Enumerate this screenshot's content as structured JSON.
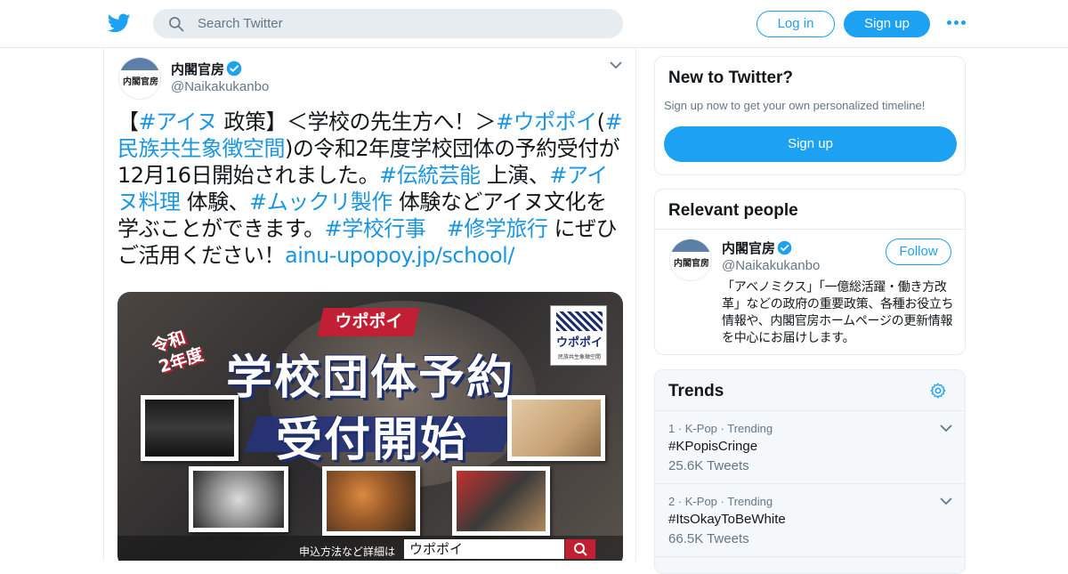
{
  "header": {
    "search_placeholder": "Search Twitter",
    "login_label": "Log in",
    "signup_label": "Sign up",
    "brand_color": "#1da1f2"
  },
  "tweet": {
    "author_name": "内閣官房",
    "author_handle": "@Naikakukanbo",
    "avatar_text": "内閣官房",
    "body": [
      {
        "t": "【",
        "k": "plain"
      },
      {
        "t": "#アイヌ",
        "k": "hashtag"
      },
      {
        "t": " 政策】＜学校の先生方へ！＞",
        "k": "plain"
      },
      {
        "t": "#ウポポイ",
        "k": "hashtag"
      },
      {
        "t": "(",
        "k": "plain"
      },
      {
        "t": "#民族共生象徴空間",
        "k": "hashtag"
      },
      {
        "t": ")の令和2年度学校団体の予約受付が12月16日開始されました。",
        "k": "plain"
      },
      {
        "t": "#伝統芸能",
        "k": "hashtag"
      },
      {
        "t": " 上演、",
        "k": "plain"
      },
      {
        "t": "#アイヌ料理",
        "k": "hashtag"
      },
      {
        "t": " 体験、",
        "k": "plain"
      },
      {
        "t": "#ムックリ製作",
        "k": "hashtag"
      },
      {
        "t": " 体験などアイヌ文化を学ぶことができます。",
        "k": "plain"
      },
      {
        "t": "#学校行事",
        "k": "hashtag"
      },
      {
        "t": "　",
        "k": "plain"
      },
      {
        "t": "#修学旅行",
        "k": "hashtag"
      },
      {
        "t": " にぜひご活用ください！",
        "k": "plain"
      },
      {
        "t": "ainu-upopoy.jp/school/",
        "k": "link"
      }
    ],
    "image": {
      "pill": "ウポポイ",
      "year_line1": "令和",
      "year_line2": "2年度",
      "headline1": "学校団体予約",
      "headline2": "受付開始",
      "logo_text": "ウポポイ",
      "logo_sub": "民族共生象徴空間",
      "bottom_label": "申込方法など詳細は",
      "bottom_search": "ウポポイ"
    }
  },
  "sidebar": {
    "new_to_twitter": {
      "title": "New to Twitter?",
      "subtitle": "Sign up now to get your own personalized timeline!",
      "button": "Sign up"
    },
    "relevant_people": {
      "title": "Relevant people",
      "name": "内閣官房",
      "handle": "@Naikakukanbo",
      "follow_label": "Follow",
      "bio": "「アベノミクス」「一億総活躍・働き方改革」などの政府の重要政策、各種お役立ち情報や、内閣官房ホームページの更新情報を中心にお届けします。"
    },
    "trends": {
      "title": "Trends",
      "items": [
        {
          "meta": "1 · K-Pop · Trending",
          "tag": "#KPopisCringe",
          "count": "25.6K Tweets"
        },
        {
          "meta": "2 · K-Pop · Trending",
          "tag": "#ItsOkayToBeWhite",
          "count": "66.5K Tweets"
        }
      ]
    }
  }
}
